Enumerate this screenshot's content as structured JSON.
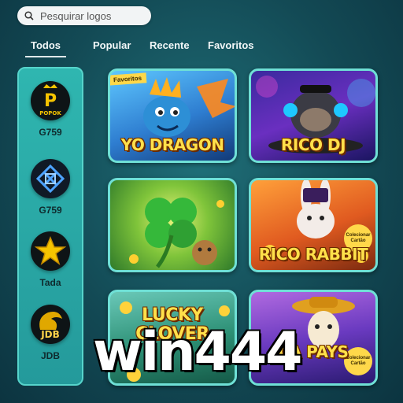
{
  "search": {
    "placeholder": "Pesquirar logos"
  },
  "tabs": [
    {
      "label": "Todos",
      "active": true
    },
    {
      "label": "Popular"
    },
    {
      "label": "Recente"
    },
    {
      "label": "Favoritos"
    }
  ],
  "sidebar": {
    "items": [
      {
        "label": "G759",
        "icon": "popok-logo-icon",
        "logo_text": "POPOK"
      },
      {
        "label": "G759",
        "icon": "knot-logo-icon"
      },
      {
        "label": "Tada",
        "icon": "star-logo-icon"
      },
      {
        "label": "JDB",
        "icon": "dragon-logo-icon",
        "logo_text": "JDB"
      }
    ]
  },
  "games": [
    {
      "title": "YO DRAGON",
      "ribbon": "Favoritos"
    },
    {
      "title": "RICO DJ"
    },
    {
      "title": ""
    },
    {
      "title": "RICO RABBIT",
      "badge": "Colecionar Cartão"
    },
    {
      "title": "LUCKY CLOVER"
    },
    {
      "title": "CA PAYS",
      "badge": "Colecionar Cartão"
    }
  ],
  "watermark": "win444",
  "colors": {
    "accent": "#6fe0d6",
    "sidebar": "#2fb6b0",
    "title": "#ffe04a"
  }
}
